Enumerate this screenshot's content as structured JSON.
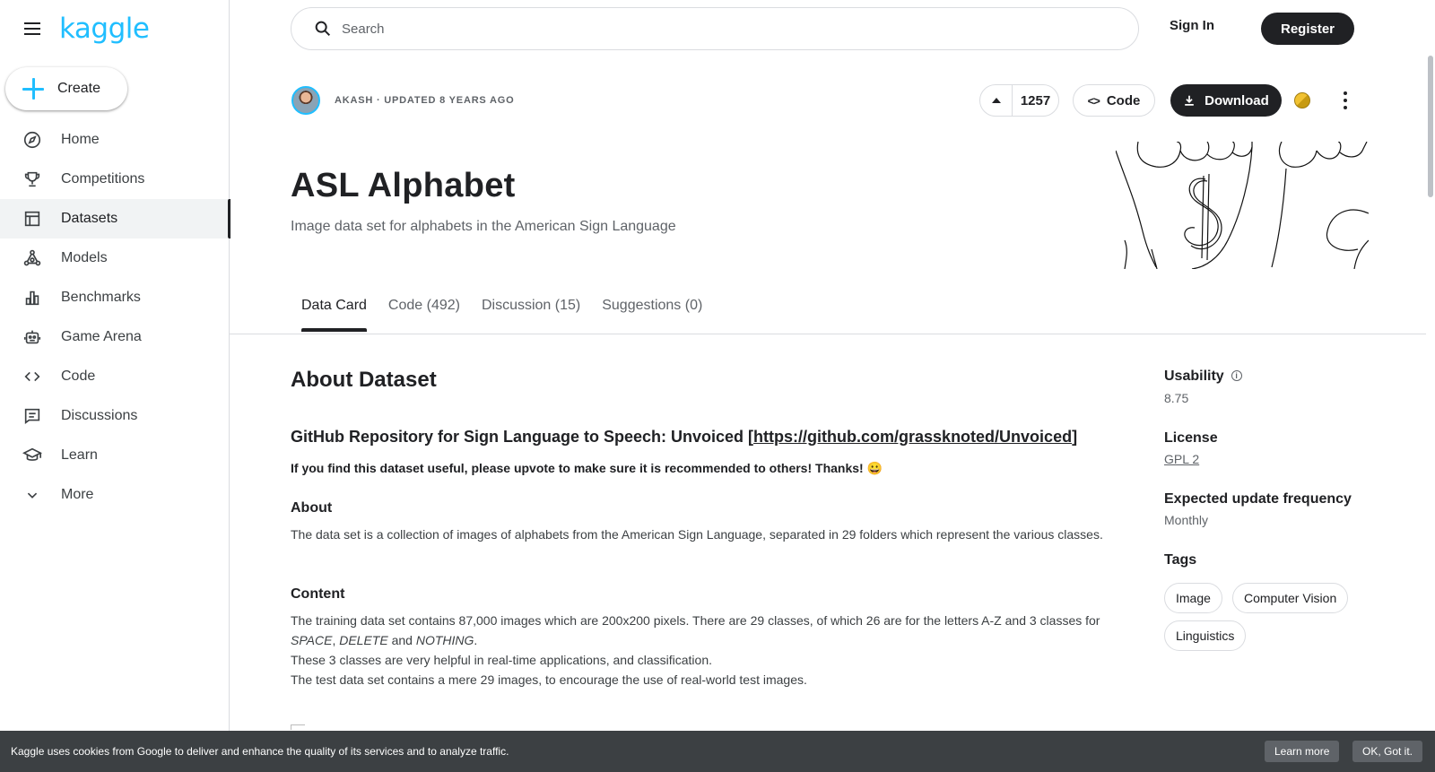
{
  "brand": {
    "logo_text": "kaggle",
    "accent": "#20beff"
  },
  "sidebar": {
    "create_label": "Create",
    "items": [
      {
        "label": "Home",
        "icon": "compass-icon"
      },
      {
        "label": "Competitions",
        "icon": "trophy-icon"
      },
      {
        "label": "Datasets",
        "icon": "table-icon",
        "active": true
      },
      {
        "label": "Models",
        "icon": "models-icon"
      },
      {
        "label": "Benchmarks",
        "icon": "bar-chart-icon"
      },
      {
        "label": "Game Arena",
        "icon": "robot-icon"
      },
      {
        "label": "Code",
        "icon": "code-icon"
      },
      {
        "label": "Discussions",
        "icon": "comment-icon"
      },
      {
        "label": "Learn",
        "icon": "school-icon"
      },
      {
        "label": "More",
        "icon": "chevron-down-icon"
      }
    ]
  },
  "header": {
    "search_placeholder": "Search",
    "signin_label": "Sign In",
    "register_label": "Register"
  },
  "dataset": {
    "meta": "AKASH · UPDATED 8 YEARS AGO",
    "upvotes": "1257",
    "code_label": "Code",
    "download_label": "Download",
    "title": "ASL Alphabet",
    "subtitle": "Image data set for alphabets in the American Sign Language"
  },
  "tabs": [
    {
      "label": "Data Card",
      "active": true
    },
    {
      "label": "Code (492)"
    },
    {
      "label": "Discussion (15)"
    },
    {
      "label": "Suggestions (0)"
    }
  ],
  "content": {
    "about_title": "About Dataset",
    "repo_prefix": "GitHub Repository for Sign Language to Speech: Unvoiced [",
    "repo_link": "https://github.com/grassknoted/Unvoiced",
    "repo_suffix": "]",
    "upvote_note": "If you find this dataset useful, please upvote to make sure it is recommended to others! Thanks! 😀",
    "about_heading": "About",
    "about_text": "The data set is a collection of images of alphabets from the American Sign Language, separated in 29 folders which represent the various classes.",
    "content_heading": "Content",
    "content_line1_a": "The training data set contains 87,000 images which are 200x200 pixels. There are 29 classes, of which 26 are for the letters A-Z and 3 classes for ",
    "content_space": "SPACE",
    "content_comma": ", ",
    "content_delete": "DELETE",
    "content_and": " and ",
    "content_nothing": "NOTHING",
    "content_period": ".",
    "content_line2": "These 3 classes are very helpful in real-time applications, and classification.",
    "content_line3": "The test data set contains a mere 29 images, to encourage the use of real-world test images."
  },
  "panel": {
    "usability_label": "Usability",
    "usability_value": "8.75",
    "license_label": "License",
    "license_value": "GPL 2",
    "frequency_label": "Expected update frequency",
    "frequency_value": "Monthly",
    "tags_label": "Tags",
    "tags": [
      "Image",
      "Computer Vision",
      "Linguistics"
    ]
  },
  "cookie": {
    "message": "Kaggle uses cookies from Google to deliver and enhance the quality of its services and to analyze traffic.",
    "learn_more": "Learn more",
    "ok": "OK, Got it."
  }
}
